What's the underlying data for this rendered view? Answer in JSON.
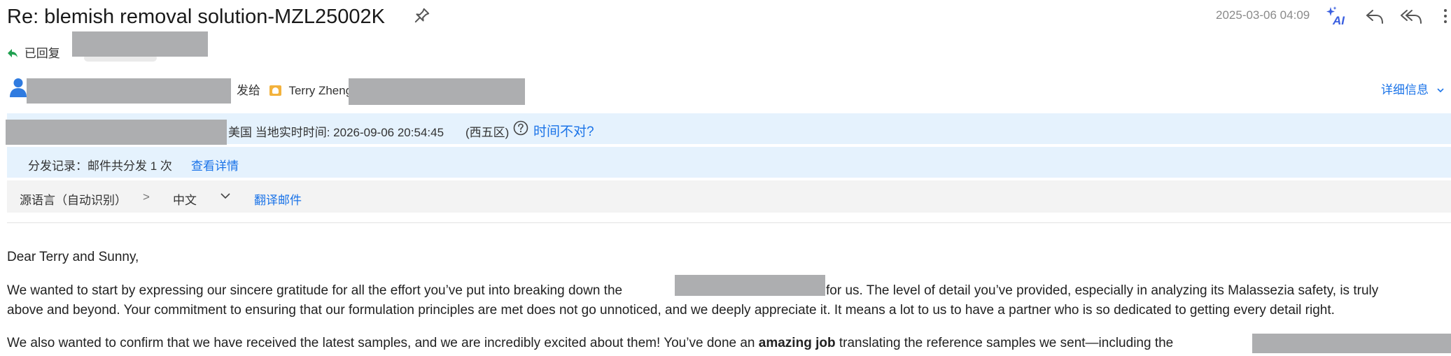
{
  "header": {
    "subject": "Re: blemish removal solution-MZL25002K",
    "datetime": "2025-03-06 04:09",
    "ai_label": "AI",
    "icons": [
      "pin-icon",
      "ai-sparkle-icon",
      "reply-icon",
      "reply-all-icon",
      "more-icon"
    ]
  },
  "status": {
    "replied_label": "已回复"
  },
  "sender": {
    "sent_to_label": "发给",
    "recipient_name": "Terry Zheng",
    "details_link": "详细信息"
  },
  "timezone_bar": {
    "text": "美国 当地实时时间: 2026-09-06 20:54:45",
    "zone": "(西五区)",
    "link": "时间不对?"
  },
  "distribution_bar": {
    "text": "分发记录：邮件共分发 1 次",
    "link": "查看详情"
  },
  "translate_bar": {
    "source_language": "源语言（自动识别）",
    "arrow": ">",
    "target_language": "中文",
    "translate_link": "翻译邮件"
  },
  "body": {
    "greeting": "Dear Terry and Sunny,",
    "p1_line1_a": "We wanted to start by expressing our sincere gratitude for all the effort you’ve put into breaking down the",
    "p1_line1_b": "for us. The level of detail you’ve provided, especially in analyzing its Malassezia safety, is truly",
    "p1_line2": "above and beyond. Your commitment to ensuring that our formulation principles are met does not go unnoticed, and we deeply appreciate it. It means a lot to us to have a partner who is so dedicated to getting every detail right.",
    "p2_a": "We also wanted to confirm that we have received the latest samples, and we are incredibly excited about them! You’ve done an",
    "p2_bold": "amazing job",
    "p2_b": "translating the reference samples we sent—including the"
  }
}
